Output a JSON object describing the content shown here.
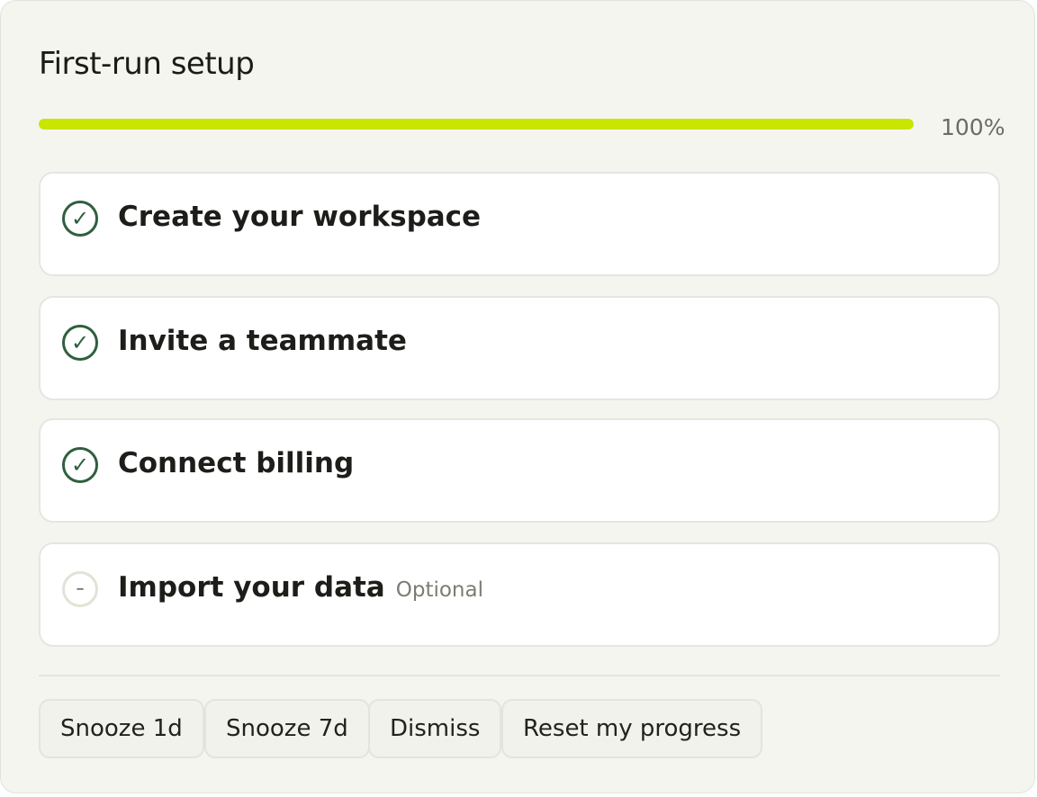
{
  "header": {
    "title": "First-run setup"
  },
  "progress": {
    "value_percent": 100,
    "label": "100%",
    "fill_color": "#c9e500"
  },
  "steps": [
    {
      "label": "Create your workspace",
      "status": "done",
      "icon": "check-circle-icon",
      "glyph": "✓"
    },
    {
      "label": "Invite a teammate",
      "status": "done",
      "icon": "check-circle-icon",
      "glyph": "✓"
    },
    {
      "label": "Connect billing",
      "status": "done",
      "icon": "check-circle-icon",
      "glyph": "✓"
    },
    {
      "label": "Import your data",
      "status": "pending",
      "icon": "minus-circle-icon",
      "glyph": "–",
      "badge": "Optional"
    }
  ],
  "actions": {
    "snooze_1d": "Snooze 1d",
    "snooze_7d": "Snooze 7d",
    "dismiss": "Dismiss",
    "reset": "Reset my progress"
  },
  "colors": {
    "done": "#2f5f3f",
    "accent": "#c9e500"
  }
}
